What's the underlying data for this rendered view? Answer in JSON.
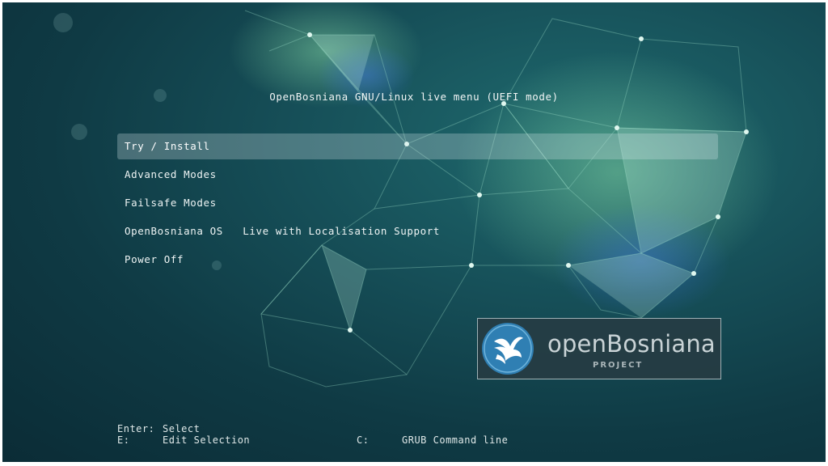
{
  "boot_menu": {
    "title": "OpenBosniana GNU/Linux live menu (UEFI mode)",
    "items": [
      {
        "label": "Try / Install",
        "selected": true
      },
      {
        "label": "Advanced Modes",
        "selected": false
      },
      {
        "label": "Failsafe Modes",
        "selected": false
      },
      {
        "label": "OpenBosniana OS   Live with Localisation Support",
        "selected": false
      },
      {
        "label": "Power Off",
        "selected": false
      }
    ]
  },
  "logo": {
    "name": "openBosniana",
    "subtitle": "PROJECT",
    "icon": "bird-logo-icon"
  },
  "help": {
    "enter_key": "Enter:",
    "enter_action": "Select",
    "e_key": "E:",
    "e_action": "Edit Selection",
    "c_key": "C:",
    "c_action": "GRUB Command line"
  },
  "colors": {
    "background": "#164f58",
    "selection": "#6f9398",
    "logo_blue": "#2f7fb3",
    "text": "#eef4f4"
  }
}
